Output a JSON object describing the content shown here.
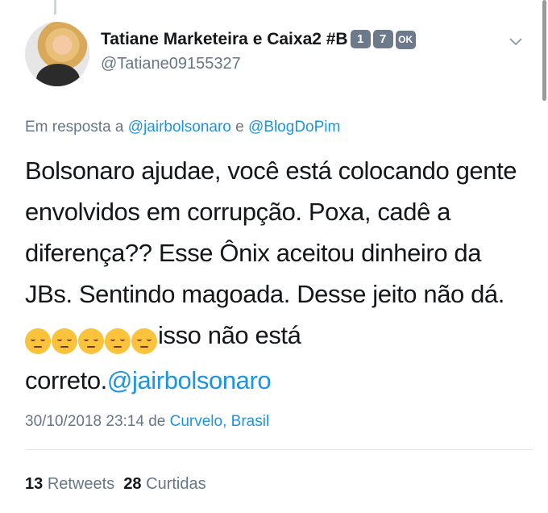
{
  "user": {
    "display_name": "Tatiane Marketeira e Caixa2 #B",
    "badges": [
      "1",
      "7",
      "OK"
    ],
    "handle": "@Tatiane09155327"
  },
  "reply": {
    "prefix": "Em resposta a",
    "user1": "@jairbolsonaro",
    "conjunction": "e",
    "user2": "@BlogDoPim"
  },
  "tweet": {
    "text_main": "Bolsonaro ajudae, você está colocando gente envolvidos em corrupção. Poxa, cadê a diferença?? Esse Ônix aceitou dinheiro da JBs. Sentindo magoada. Desse jeito não dá. ",
    "emoji_name": "pensive-face-emoji",
    "emoji_count": 5,
    "text_after_emoji": "isso não está correto.",
    "mention": "@jairbolsonaro"
  },
  "meta": {
    "datetime": "30/10/2018 23:14",
    "preposition": "de",
    "location": "Curvelo, Brasil"
  },
  "stats": {
    "retweets_count": "13",
    "retweets_label": "Retweets",
    "likes_count": "28",
    "likes_label": "Curtidas"
  },
  "colors": {
    "link": "#1b95e0",
    "secondary_text": "#657786",
    "primary_text": "#14171a",
    "badge": "#6c7a8c"
  }
}
